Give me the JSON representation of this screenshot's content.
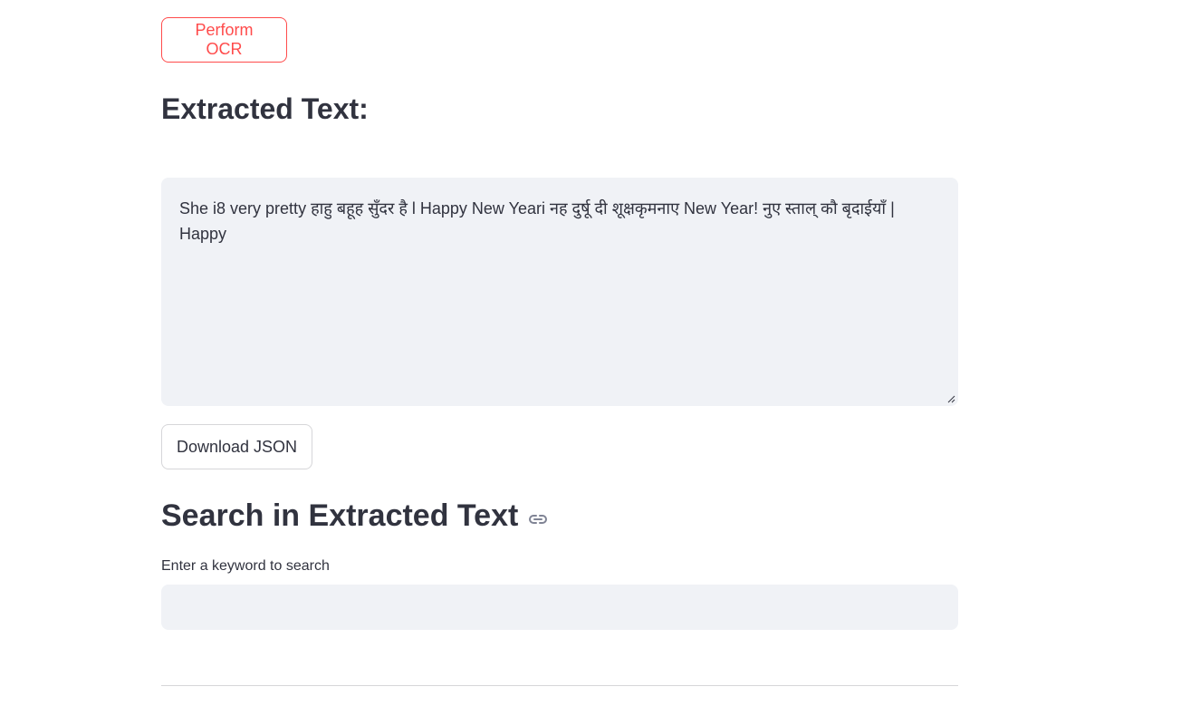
{
  "actions": {
    "ocr_button_label": "Perform OCR",
    "download_button_label": "Download JSON"
  },
  "extracted": {
    "heading": "Extracted Text:",
    "text": "She i8 very pretty हाहु बहूह सुँदर है l Happy New Yeari नह दुर्षू दी शूक्षकृमनाए New Year! नुए स्ताल् कौ बृदाईयाँ | Happy"
  },
  "search": {
    "heading": "Search in Extracted Text",
    "label": "Enter a keyword to search",
    "value": "",
    "placeholder": ""
  },
  "colors": {
    "accent": "#ff4b4b",
    "text": "#31333f",
    "field_background": "#f0f2f6"
  },
  "icons": {
    "heading_anchor": "link-icon",
    "textarea_resize": "resize-handle-icon"
  }
}
